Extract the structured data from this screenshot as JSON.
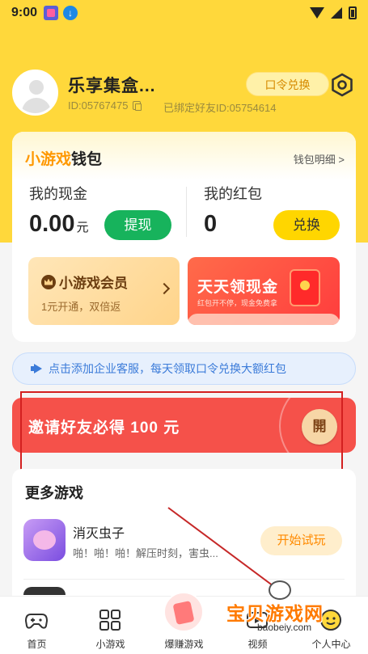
{
  "status_bar": {
    "time": "9:00",
    "download_icon": "download-icon"
  },
  "profile": {
    "nickname": "乐享集盒...",
    "user_id": "ID:05767475",
    "bound_friend": "已绑定好友ID:05754614",
    "code_redeem_label": "口令兑换"
  },
  "wallet": {
    "title_accent": "小游戏",
    "title_rest": "钱包",
    "detail_link": "钱包明细 >",
    "cash_label": "我的现金",
    "cash_value": "0.00",
    "cash_unit": "元",
    "withdraw_label": "提现",
    "redpack_label": "我的红包",
    "redpack_value": "0",
    "exchange_label": "兑换",
    "member_title": "小游戏会员",
    "member_sub": "1元开通，双倍返",
    "cash_banner_title": "天天领现金",
    "cash_banner_sub": "红包开不停，现金免费拿"
  },
  "notice": {
    "text": "点击添加企业客服，每天领取口令兑换大额红包"
  },
  "invite": {
    "text": "邀请好友必得 100 元",
    "open_label": "開"
  },
  "more_games": {
    "title": "更多游戏",
    "items": [
      {
        "name": "消灭虫子",
        "desc": "啪！啪！啪！解压时刻，害虫...",
        "button": "开始试玩"
      }
    ]
  },
  "bottom_nav": {
    "items": [
      {
        "label": "首页",
        "icon": "gamepad-icon"
      },
      {
        "label": "小游戏",
        "icon": "grid-icon"
      },
      {
        "label": "爆赚游戏",
        "icon": "money-icon"
      },
      {
        "label": "视频",
        "icon": "video-icon"
      },
      {
        "label": "个人中心",
        "icon": "smile-icon"
      }
    ]
  },
  "watermark": {
    "text": "宝贝游戏网",
    "url": "baobeiy.com"
  },
  "colors": {
    "brand_yellow": "#ffd83b",
    "withdraw_green": "#17b35c",
    "invite_red": "#f5514a",
    "notice_blue": "#3b7bd9"
  }
}
